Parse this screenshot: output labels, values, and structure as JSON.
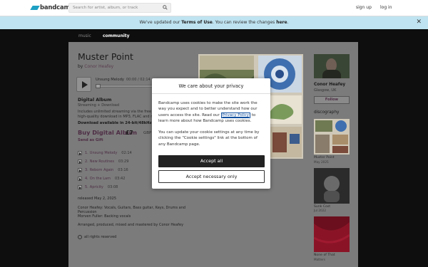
{
  "topbar": {
    "logo_text": "bandcamp",
    "search_placeholder": "Search for artist, album, or track",
    "signup_label": "sign up",
    "login_label": "log in"
  },
  "banner": {
    "prefix": "We've updated our ",
    "terms_link": "Terms of Use",
    "middle": ". You can review the changes ",
    "here_link": "here",
    "suffix": "."
  },
  "nav": {
    "tabs": [
      "music",
      "community"
    ],
    "active": "community"
  },
  "album": {
    "title": "Muster Point",
    "by_prefix": "by ",
    "artist": "Conor Heafey",
    "player": {
      "track": "Unsung Melody",
      "time": "00:00 / 02:14"
    },
    "digital": {
      "title": "Digital Album",
      "sub": "Streaming + Download",
      "desc_line1": "Includes unlimited streaming via the free",
      "desc_line2": "high-quality download in MP3, FLAC and m",
      "download_line": "Download available in 24-bit/48kHz."
    },
    "buy_label": "Buy Digital Album",
    "price": "£7",
    "price_currency": "GBP",
    "send_gift": "Send as Gift",
    "tracks": [
      {
        "num": "1.",
        "title": "Unsung Melody",
        "len": "02:14"
      },
      {
        "num": "2.",
        "title": "New Routines",
        "len": "03:29"
      },
      {
        "num": "3.",
        "title": "Reborn Again",
        "len": "03:16"
      },
      {
        "num": "4.",
        "title": "On the Lam",
        "len": "03:42"
      },
      {
        "num": "5.",
        "title": "Apricity",
        "len": "03:08"
      }
    ],
    "released": "released May 2, 2025",
    "credits_line1": "Conor Heafey: Vocals, Guitars, Bass guitar, Keys, Drums and",
    "credits_line2": "Percussion",
    "credits_line3": "Morven Fuller: Backing vocals",
    "arranged": "Arranged, produced, mixed and mastered by Conor Heafey",
    "rights": "all rights reserved"
  },
  "sidebar": {
    "name": "Conor Heafey",
    "location": "Glasgow, UK",
    "follow_label": "Follow",
    "discography_label": "discography",
    "items": [
      {
        "title": "Muster Point",
        "date": "May 2025"
      },
      {
        "title": "Sunk Cost",
        "date": "Jul 2022"
      },
      {
        "title": "None of That",
        "date": "Matters"
      }
    ]
  },
  "cookie_modal": {
    "title": "We care about your privacy",
    "p1_before": "Bandcamp uses cookies to make the site work the way you expect and to better understand how our users access the site. Read our ",
    "p1_link": "Privacy Policy",
    "p1_after": " to learn more about how Bandcamp uses cookies.",
    "p2": "You can update your cookie settings at any time by clicking the \"Cookie settings\" link at the bottom of any Bandcamp page.",
    "accept_all": "Accept all",
    "accept_necessary": "Accept necessary only"
  },
  "icons": {
    "search": "search-icon",
    "close": "close-icon",
    "play": "play-icon"
  },
  "colors": {
    "brand": "#1da0c3",
    "banner_bg": "#bfe3f0",
    "link_accent": "#4e2e45"
  }
}
